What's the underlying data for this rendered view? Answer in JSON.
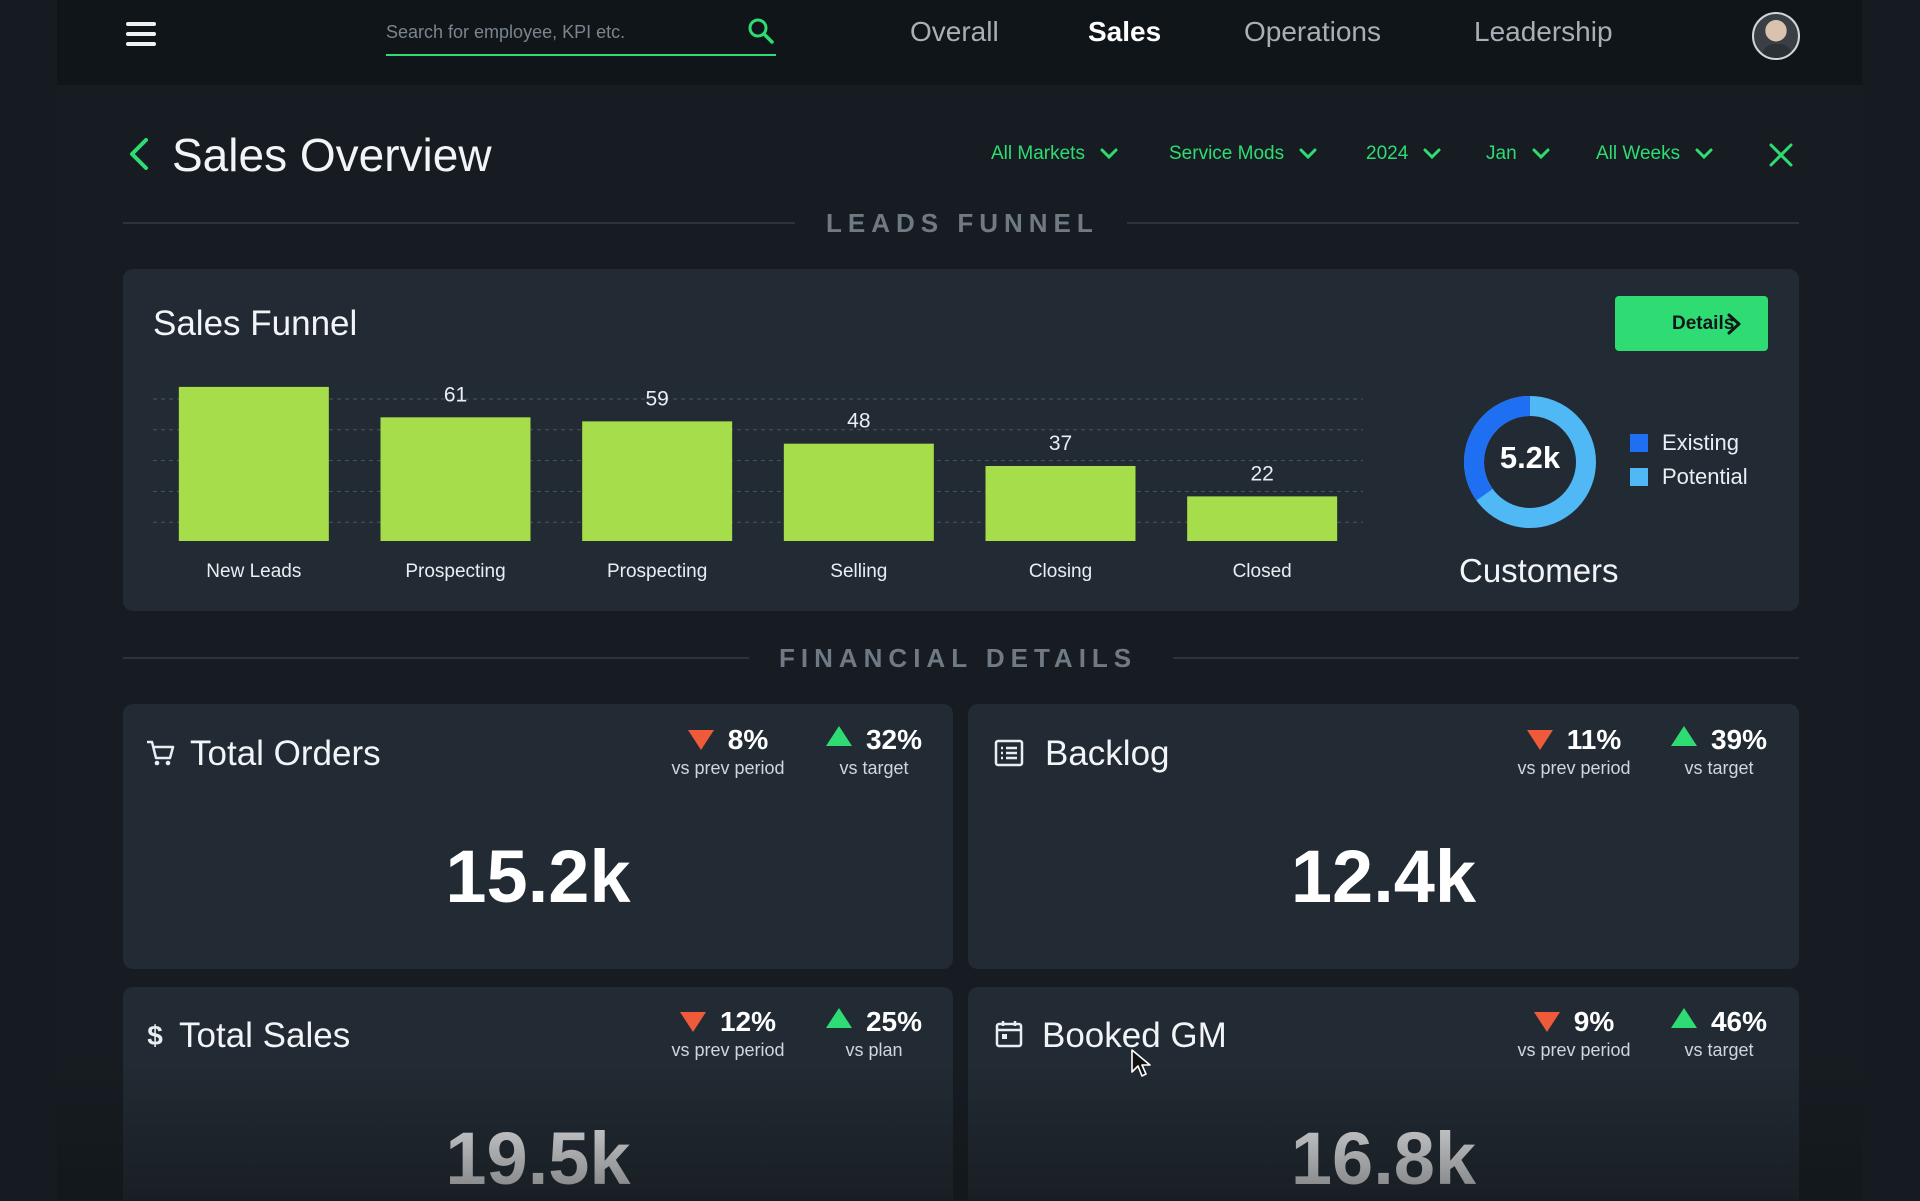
{
  "search": {
    "placeholder": "Search for employee, KPI etc."
  },
  "nav": {
    "tabs": [
      {
        "label": "Overall",
        "active": false
      },
      {
        "label": "Sales",
        "active": true
      },
      {
        "label": "Operations",
        "active": false
      },
      {
        "label": "Leadership",
        "active": false
      }
    ]
  },
  "header": {
    "title": "Sales Overview",
    "filters": [
      "All Markets",
      "Service Mods",
      "2024",
      "Jan",
      "All Weeks"
    ]
  },
  "sections": {
    "leads": "LEADS FUNNEL",
    "financial": "FINANCIAL DETAILS"
  },
  "funnel_card": {
    "title": "Sales Funnel",
    "details_label": "Details",
    "highlight_icon": "sparkle-icon"
  },
  "chart_data": {
    "type": "bar",
    "categories": [
      "New Leads",
      "Prospecting",
      "Prospecting",
      "Selling",
      "Closing",
      "Closed"
    ],
    "values": [
      76,
      61,
      59,
      48,
      37,
      22
    ],
    "title": "Sales Funnel",
    "xlabel": "",
    "ylabel": "",
    "ylim": [
      0,
      100
    ],
    "grid": true,
    "color": "#a6dd4a"
  },
  "customers": {
    "value": "5.2k",
    "caption": "Customers",
    "legend": [
      {
        "label": "Existing",
        "color": "#1f6ff2"
      },
      {
        "label": "Potential",
        "color": "#4fb8f5"
      }
    ],
    "existing_share": 0.35
  },
  "kpis": [
    {
      "title": "Total Orders",
      "icon": "cart-icon",
      "value": "15.2k",
      "prev_pct": "8%",
      "prev_label": "vs prev period",
      "prev_dir": "down",
      "target_pct": "32%",
      "target_label": "vs target",
      "target_dir": "up"
    },
    {
      "title": "Backlog",
      "icon": "list-icon",
      "value": "12.4k",
      "prev_pct": "11%",
      "prev_label": "vs prev period",
      "prev_dir": "down",
      "target_pct": "39%",
      "target_label": "vs target",
      "target_dir": "up"
    },
    {
      "title": "Total Sales",
      "icon": "dollar-icon",
      "value": "19.5k",
      "prev_pct": "12%",
      "prev_label": "vs prev period",
      "prev_dir": "down",
      "target_pct": "25%",
      "target_label": "vs plan",
      "target_dir": "up"
    },
    {
      "title": "Booked GM",
      "icon": "calendar-icon",
      "value": "16.8k",
      "prev_pct": "9%",
      "prev_label": "vs prev period",
      "prev_dir": "down",
      "target_pct": "46%",
      "target_label": "vs target",
      "target_dir": "up"
    }
  ],
  "colors": {
    "accent": "#2fdc73",
    "down": "#ef5a3a",
    "up": "#2fdc73",
    "card": "#222b33"
  }
}
